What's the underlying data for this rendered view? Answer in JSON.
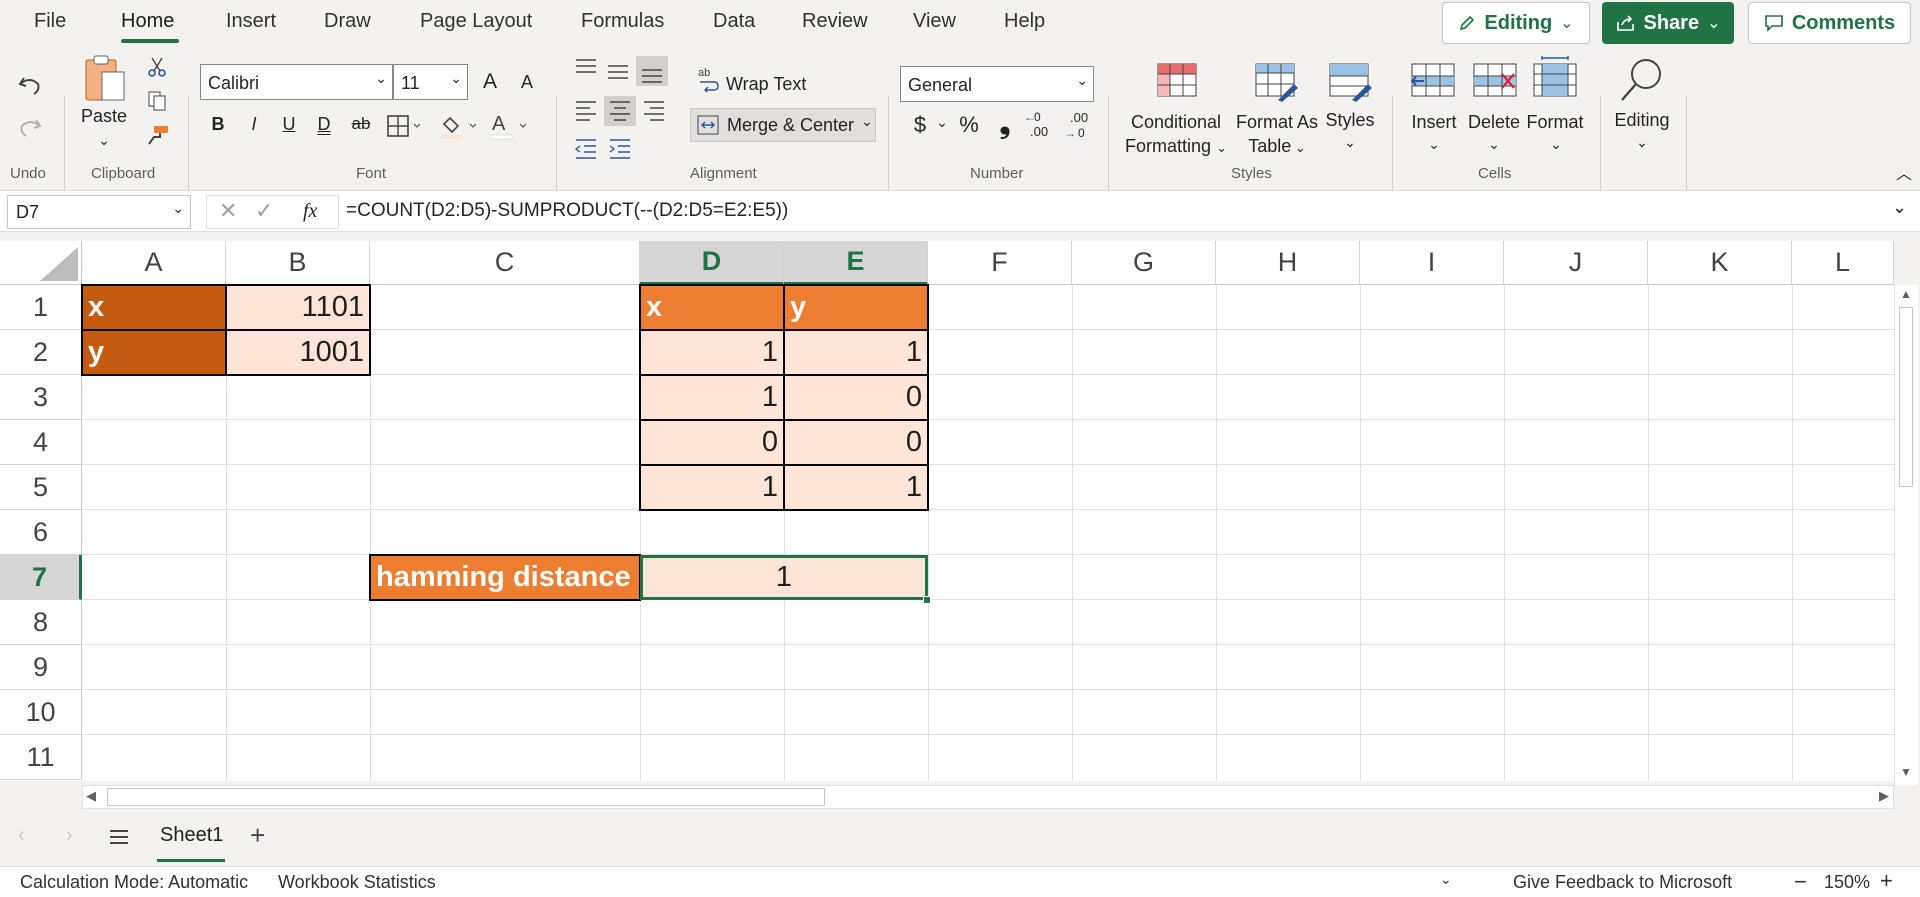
{
  "menu": {
    "tabs": [
      "File",
      "Home",
      "Insert",
      "Draw",
      "Page Layout",
      "Formulas",
      "Data",
      "Review",
      "View",
      "Help"
    ],
    "active_tab": "Home",
    "editing_label": "Editing",
    "share_label": "Share",
    "comments_label": "Comments"
  },
  "ribbon": {
    "undo_group": "Undo",
    "clipboard_group": "Clipboard",
    "paste_label": "Paste",
    "font_group": "Font",
    "font_name": "Calibri",
    "font_size": "11",
    "alignment_group": "Alignment",
    "wrap_text": "Wrap Text",
    "merge_center": "Merge & Center",
    "number_group": "Number",
    "number_format": "General",
    "styles_group": "Styles",
    "conditional_1": "Conditional",
    "conditional_2": "Formatting",
    "format_as_1": "Format As",
    "format_as_2": "Table",
    "styles_label": "Styles",
    "cells_group": "Cells",
    "insert_label": "Insert",
    "delete_label": "Delete",
    "format_label": "Format",
    "editing_label": "Editing",
    "bold": "B",
    "italic": "I",
    "underline": "U",
    "double_underline": "D",
    "strike": "ab",
    "grow": "A",
    "shrink": "A",
    "currency": "$",
    "percent": "%",
    "comma": "❟",
    "inc_dec": ".00",
    "dec_dec": ".00"
  },
  "formula_bar": {
    "name_box": "D7",
    "fx": "fx",
    "formula": "=COUNT(D2:D5)-SUMPRODUCT(--(D2:D5=E2:E5))"
  },
  "grid": {
    "columns": [
      "A",
      "B",
      "C",
      "D",
      "E",
      "F",
      "G",
      "H",
      "I",
      "J",
      "K",
      "L"
    ],
    "rows": [
      "1",
      "2",
      "3",
      "4",
      "5",
      "6",
      "7",
      "8",
      "9",
      "10",
      "11"
    ],
    "selected_cell": "D7"
  },
  "cells": {
    "A1": "x",
    "B1": "1101",
    "A2": "y",
    "B2": "1001",
    "D1": "x",
    "E1": "y",
    "D2": "1",
    "E2": "1",
    "D3": "1",
    "E3": "0",
    "D4": "0",
    "E4": "0",
    "D5": "1",
    "E5": "1",
    "C7": "hamming distance",
    "D7": "1"
  },
  "sheets": {
    "tabs": [
      "Sheet1"
    ],
    "active": "Sheet1"
  },
  "status": {
    "calc_mode": "Calculation Mode: Automatic",
    "workbook_stats": "Workbook Statistics",
    "feedback": "Give Feedback to Microsoft",
    "zoom": "150%"
  },
  "colors": {
    "accent": "#217346",
    "header_dark": "#c55a11",
    "header_orange": "#ed7d31",
    "peach": "#fce4d6"
  }
}
